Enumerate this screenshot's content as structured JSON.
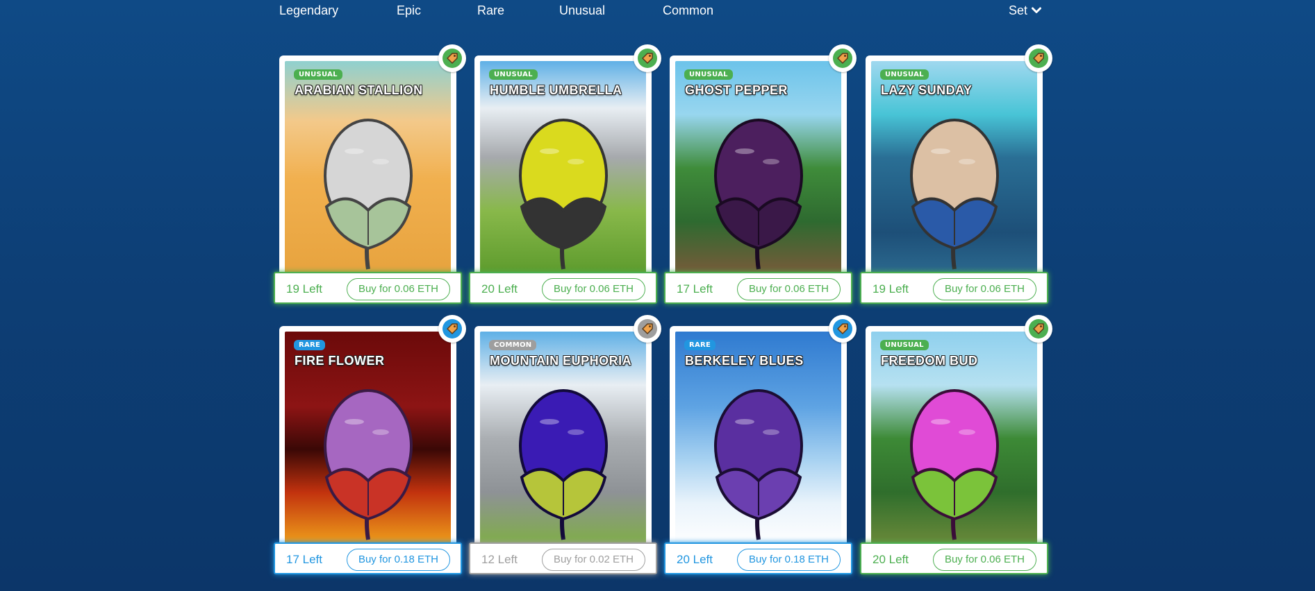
{
  "filters": {
    "items": [
      "Legendary",
      "Epic",
      "Rare",
      "Unusual",
      "Common"
    ],
    "set_label": "Set"
  },
  "colors": {
    "unusual": "#4caf50",
    "rare": "#2196e0",
    "common": "#9e9e9e",
    "background": "#0f4a86"
  },
  "cards": [
    {
      "rarity": "UNUSUAL",
      "title": "ARABIAN STALLION",
      "left": "19 Left",
      "buy": "Buy for 0.06 ETH",
      "tier": "unusual",
      "theme": "desert"
    },
    {
      "rarity": "UNUSUAL",
      "title": "HUMBLE UMBRELLA",
      "left": "20 Left",
      "buy": "Buy for 0.06 ETH",
      "tier": "unusual",
      "theme": "mountain-yellow"
    },
    {
      "rarity": "UNUSUAL",
      "title": "GHOST PEPPER",
      "left": "17 Left",
      "buy": "Buy for 0.06 ETH",
      "tier": "unusual",
      "theme": "forest-dark"
    },
    {
      "rarity": "UNUSUAL",
      "title": "LAZY SUNDAY",
      "left": "19 Left",
      "buy": "Buy for 0.06 ETH",
      "tier": "unusual",
      "theme": "ocean"
    },
    {
      "rarity": "RARE",
      "title": "FIRE FLOWER",
      "left": "17 Left",
      "buy": "Buy for 0.18 ETH",
      "tier": "rare",
      "theme": "lava"
    },
    {
      "rarity": "COMMON",
      "title": "MOUNTAIN EUPHORIA",
      "left": "12 Left",
      "buy": "Buy for 0.02 ETH",
      "tier": "common",
      "theme": "mountain-blue"
    },
    {
      "rarity": "RARE",
      "title": "BERKELEY BLUES",
      "left": "20 Left",
      "buy": "Buy for 0.18 ETH",
      "tier": "rare",
      "theme": "snow"
    },
    {
      "rarity": "UNUSUAL",
      "title": "FREEDOM BUD",
      "left": "20 Left",
      "buy": "Buy for 0.06 ETH",
      "tier": "unusual",
      "theme": "forest-pink"
    }
  ]
}
